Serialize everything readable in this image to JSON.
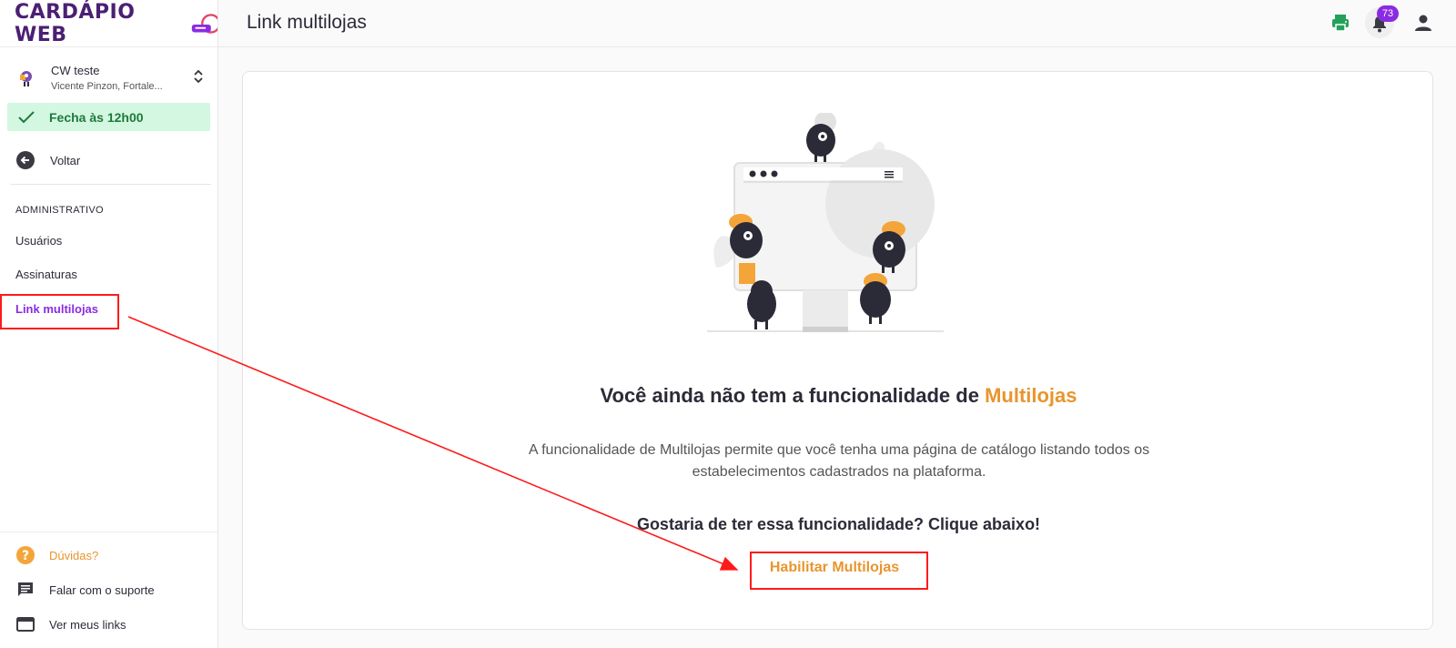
{
  "brand": {
    "logo_text": "CARDÁPIO WEB"
  },
  "sidebar": {
    "store": {
      "name": "CW teste",
      "address": "Vicente Pinzon, Fortale..."
    },
    "status": {
      "label": "Fecha às 12h00",
      "color": "#1e7a3c"
    },
    "back_label": "Voltar",
    "section_title": "ADMINISTRATIVO",
    "nav_items": [
      {
        "label": "Usuários"
      },
      {
        "label": "Assinaturas"
      },
      {
        "label": "Link multilojas",
        "active": true
      }
    ],
    "bottom_items": [
      {
        "label": "Dúvidas?",
        "icon": "help-icon"
      },
      {
        "label": "Falar com o suporte",
        "icon": "chat-icon"
      },
      {
        "label": "Ver meus links",
        "icon": "window-icon"
      }
    ]
  },
  "header": {
    "title": "Link multilojas",
    "notifications_count": "73",
    "icons": [
      "print-icon",
      "bell-icon",
      "user-icon"
    ]
  },
  "main": {
    "headline_prefix": "Você ainda não tem a funcionalidade de",
    "headline_accent": "Multilojas",
    "description": "A funcionalidade de Multilojas permite que você tenha uma página de catálogo listando todos os estabelecimentos cadastrados na plataforma.",
    "cta_text": "Gostaria de ter essa funcionalidade? Clique abaixo!",
    "button_label": "Habilitar Multilojas"
  },
  "colors": {
    "accent_orange": "#e8952e",
    "accent_purple": "#8a2be2",
    "annotation_red": "#ff1a1a",
    "status_bg": "#d4f7e1"
  }
}
